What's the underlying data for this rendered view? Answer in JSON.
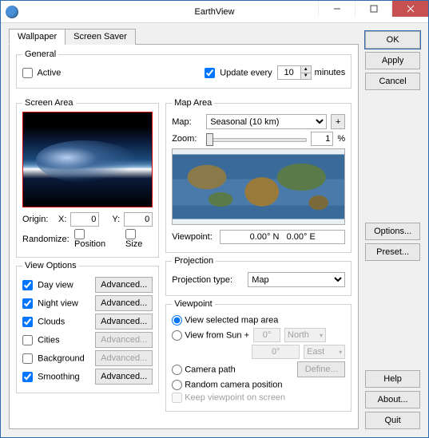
{
  "window": {
    "title": "EarthView"
  },
  "tabs": {
    "wallpaper": "Wallpaper",
    "screensaver": "Screen Saver"
  },
  "general": {
    "legend": "General",
    "active_label": "Active",
    "active_checked": false,
    "update_label": "Update every",
    "update_checked": true,
    "update_value": "10",
    "update_unit": "minutes"
  },
  "screen_area": {
    "legend": "Screen Area",
    "origin_label": "Origin:",
    "x_label": "X:",
    "x_value": "0",
    "y_label": "Y:",
    "y_value": "0",
    "randomize_label": "Randomize:",
    "position_label": "Position",
    "size_label": "Size"
  },
  "view_options": {
    "legend": "View Options",
    "items": [
      {
        "label": "Day view",
        "checked": true,
        "adv_enabled": true
      },
      {
        "label": "Night view",
        "checked": true,
        "adv_enabled": true
      },
      {
        "label": "Clouds",
        "checked": true,
        "adv_enabled": true
      },
      {
        "label": "Cities",
        "checked": false,
        "adv_enabled": false
      },
      {
        "label": "Background",
        "checked": false,
        "adv_enabled": false
      },
      {
        "label": "Smoothing",
        "checked": true,
        "adv_enabled": true
      }
    ],
    "advanced_label": "Advanced..."
  },
  "map_area": {
    "legend": "Map Area",
    "map_label": "Map:",
    "map_value": "Seasonal (10 km)",
    "plus": "+",
    "zoom_label": "Zoom:",
    "zoom_value": "1",
    "zoom_unit": "%",
    "viewpoint_label": "Viewpoint:",
    "viewpoint_value": "0.00° N   0.00° E"
  },
  "projection": {
    "legend": "Projection",
    "type_label": "Projection type:",
    "type_value": "Map"
  },
  "viewpoint": {
    "legend": "Viewpoint",
    "view_selected_label": "View selected map area",
    "view_from_sun_label": "View from Sun +",
    "deg1": "0°",
    "dir1": "North",
    "deg2": "0°",
    "dir2": "East",
    "camera_path_label": "Camera path",
    "define_label": "Define...",
    "random_label": "Random camera position",
    "keep_label": "Keep viewpoint on screen"
  },
  "buttons": {
    "ok": "OK",
    "apply": "Apply",
    "cancel": "Cancel",
    "options": "Options...",
    "preset": "Preset...",
    "help": "Help",
    "about": "About...",
    "quit": "Quit"
  }
}
